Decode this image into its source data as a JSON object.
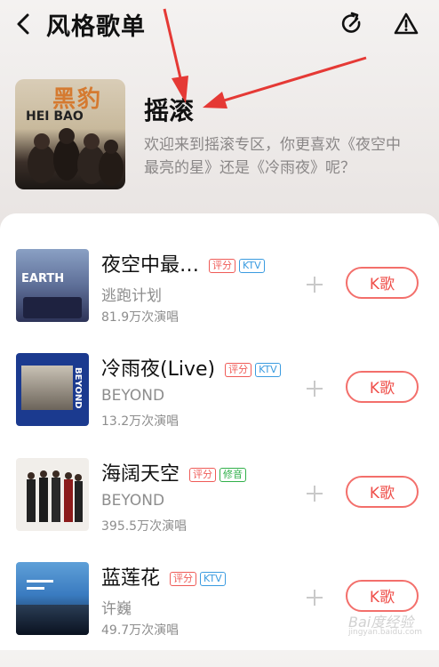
{
  "header": {
    "title": "风格歌单"
  },
  "hero": {
    "cover_text": "HEI BAO",
    "cover_logo": "黑豹",
    "title": "摇滚",
    "description": "欢迎来到摇滚专区，你更喜欢《夜空中最亮的星》还是《冷雨夜》呢？"
  },
  "songs": [
    {
      "name": "夜空中最…",
      "tags": [
        "评分",
        "KTV"
      ],
      "artist": "逃跑计划",
      "plays": "81.9万次演唱",
      "button": "K歌",
      "cover_text": "EARTH"
    },
    {
      "name": "冷雨夜(Live)",
      "tags": [
        "评分",
        "KTV"
      ],
      "artist": "BEYOND",
      "plays": "13.2万次演唱",
      "button": "K歌",
      "cover_text": "BEYOND"
    },
    {
      "name": "海阔天空",
      "tags": [
        "评分",
        "修音"
      ],
      "artist": "BEYOND",
      "plays": "395.5万次演唱",
      "button": "K歌"
    },
    {
      "name": "蓝莲花",
      "tags": [
        "评分",
        "KTV"
      ],
      "artist": "许巍",
      "plays": "49.7万次演唱",
      "button": "K歌"
    }
  ],
  "watermark": {
    "brand": "Bai度经验",
    "url": "jingyan.baidu.com"
  },
  "colors": {
    "accent": "#ef4f4a",
    "ktv": "#3a9be0",
    "fix": "#31b04a",
    "arrow": "#e53935"
  }
}
